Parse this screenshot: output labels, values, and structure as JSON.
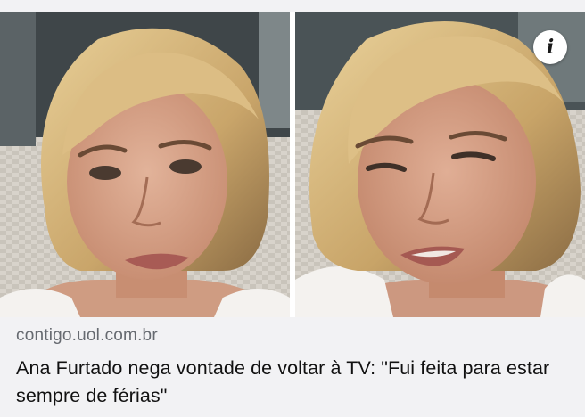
{
  "article": {
    "source": "contigo.uol.com.br",
    "headline": "Ana Furtado nega vontade de voltar à TV: \"Fui feita para estar sempre de férias\""
  },
  "info_button": {
    "label": "i",
    "icon": "info-icon"
  },
  "images": [
    {
      "name": "photo-left"
    },
    {
      "name": "photo-right"
    }
  ],
  "colors": {
    "card_background": "#f2f2f4",
    "source_text": "#666a70",
    "headline_text": "#111111"
  }
}
